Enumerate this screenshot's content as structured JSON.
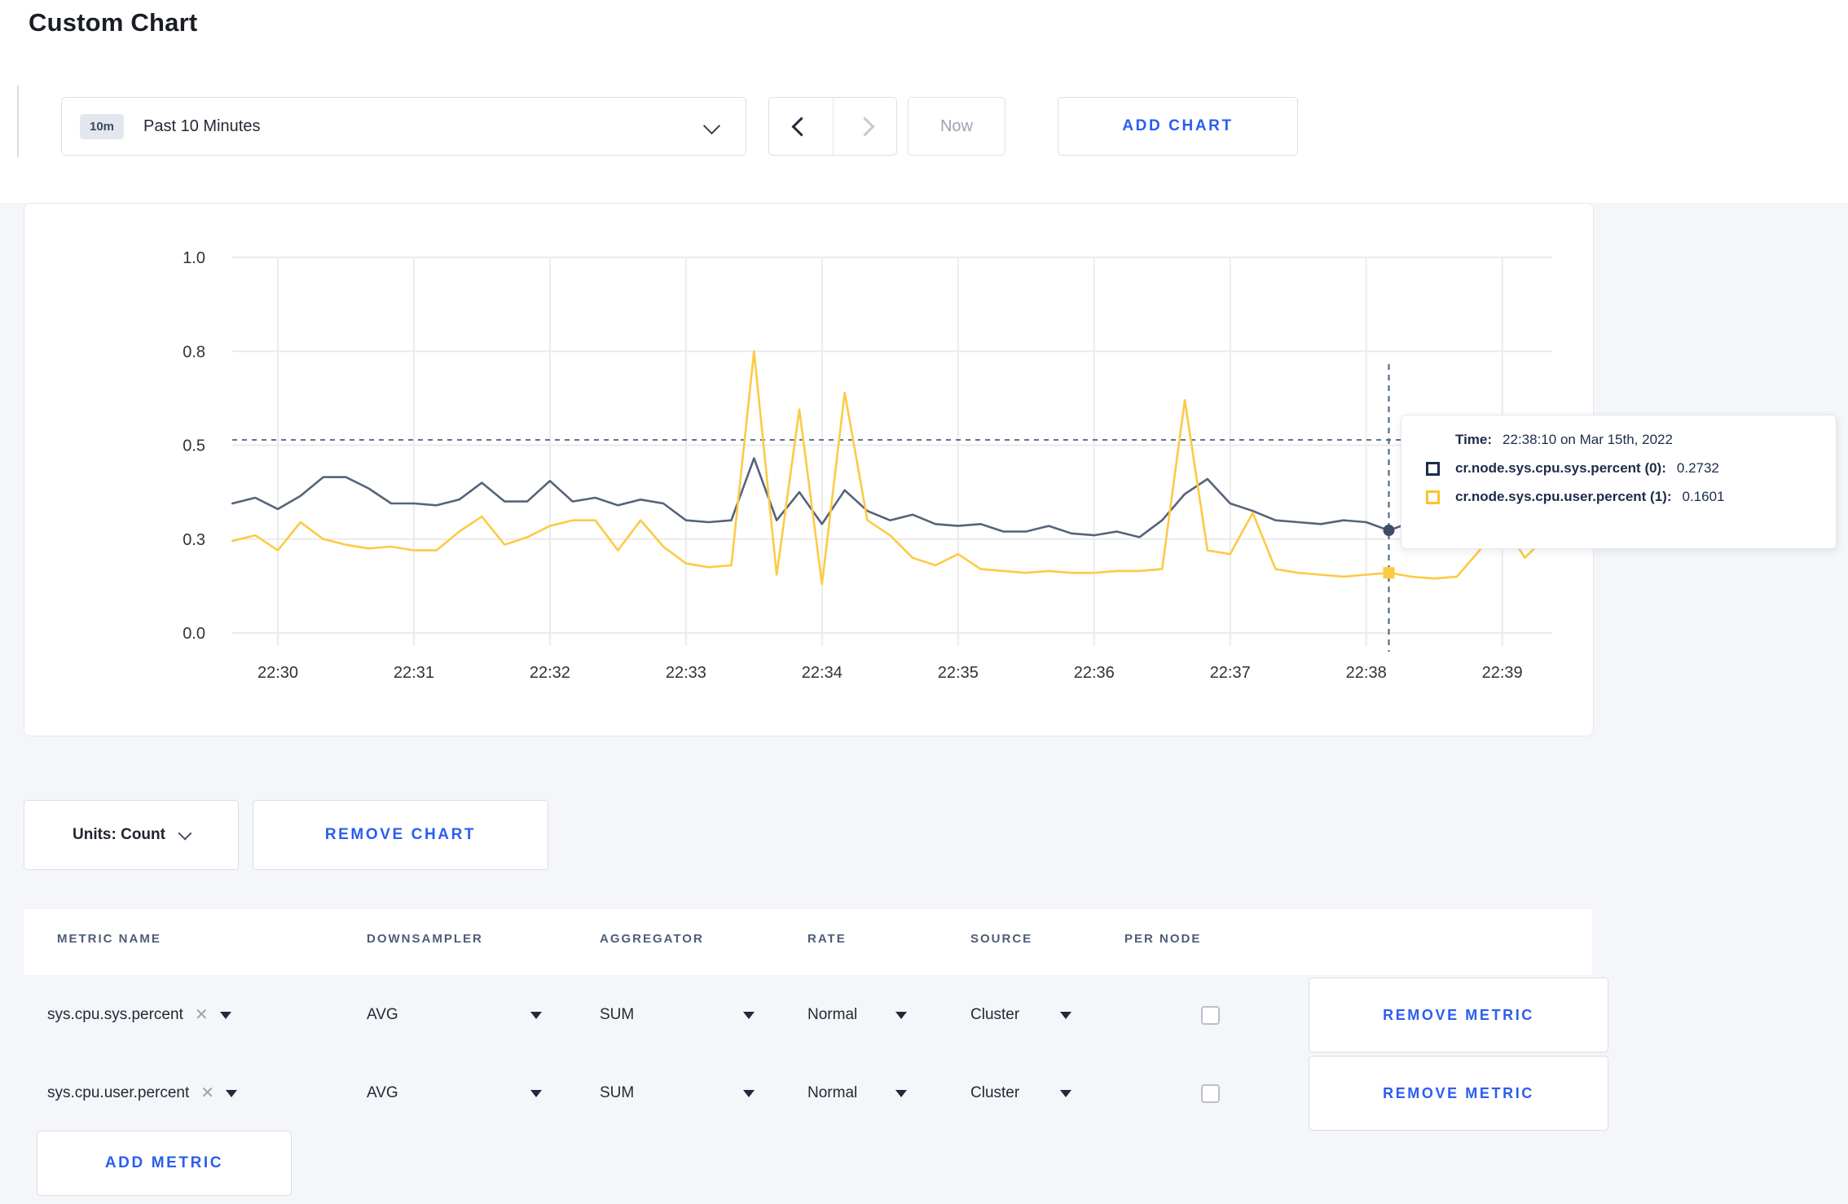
{
  "page": {
    "title": "Custom Chart",
    "background": "#f4f6f9",
    "accent_blue": "#2b5df0"
  },
  "toolbar": {
    "time_badge": "10m",
    "time_label": "Past 10 Minutes",
    "now_label": "Now",
    "add_chart_label": "ADD CHART"
  },
  "chart_data": {
    "type": "line",
    "title": "",
    "xlabel": "",
    "ylabel": "",
    "ylim": [
      0,
      1
    ],
    "grid": true,
    "x_tick_labels": [
      "22:30",
      "22:31",
      "22:32",
      "22:33",
      "22:34",
      "22:35",
      "22:36",
      "22:37",
      "22:38",
      "22:39"
    ],
    "y_ticks": [
      {
        "value": 0.0,
        "label": "0.0"
      },
      {
        "value": 0.25,
        "label": "0.3"
      },
      {
        "value": 0.5,
        "label": "0.5"
      },
      {
        "value": 0.75,
        "label": "0.8"
      },
      {
        "value": 1.0,
        "label": "1.0"
      }
    ],
    "start_time": "22:29:40",
    "step_seconds": 10,
    "series": [
      {
        "name": "cr.node.sys.cpu.sys.percent",
        "color": "#56637a",
        "values": [
          0.345,
          0.36,
          0.33,
          0.365,
          0.415,
          0.415,
          0.385,
          0.345,
          0.345,
          0.34,
          0.355,
          0.4,
          0.35,
          0.35,
          0.405,
          0.35,
          0.36,
          0.34,
          0.355,
          0.345,
          0.3,
          0.295,
          0.3,
          0.465,
          0.3,
          0.375,
          0.29,
          0.38,
          0.325,
          0.3,
          0.315,
          0.29,
          0.285,
          0.29,
          0.27,
          0.27,
          0.285,
          0.265,
          0.26,
          0.27,
          0.255,
          0.3,
          0.37,
          0.41,
          0.345,
          0.325,
          0.3,
          0.295,
          0.29,
          0.3,
          0.295,
          0.2732,
          0.295,
          0.31,
          0.3,
          0.295,
          0.3,
          0.305,
          0.3
        ]
      },
      {
        "name": "cr.node.sys.cpu.user.percent",
        "color": "#fdca44",
        "values": [
          0.245,
          0.26,
          0.22,
          0.295,
          0.25,
          0.235,
          0.225,
          0.23,
          0.22,
          0.22,
          0.27,
          0.31,
          0.235,
          0.255,
          0.285,
          0.3,
          0.3,
          0.22,
          0.3,
          0.23,
          0.185,
          0.175,
          0.18,
          0.75,
          0.155,
          0.595,
          0.13,
          0.64,
          0.3,
          0.26,
          0.2,
          0.18,
          0.21,
          0.17,
          0.165,
          0.16,
          0.165,
          0.16,
          0.16,
          0.165,
          0.165,
          0.17,
          0.62,
          0.22,
          0.21,
          0.32,
          0.17,
          0.16,
          0.155,
          0.15,
          0.155,
          0.1601,
          0.15,
          0.145,
          0.15,
          0.22,
          0.295,
          0.2,
          0.26
        ]
      }
    ],
    "hover": {
      "index": 51,
      "time": "22:38:10",
      "hline_value": 0.514,
      "sys_value": 0.2732,
      "user_value": 0.1601
    },
    "legend_position": "tooltip-overlay"
  },
  "tooltip": {
    "time_label": "Time:",
    "time_value": "22:38:10 on Mar 15th, 2022",
    "rows": [
      {
        "name": "cr.node.sys.cpu.sys.percent (0):",
        "value": "0.2732",
        "color": "#1c2c4a"
      },
      {
        "name": "cr.node.sys.cpu.user.percent (1):",
        "value": "0.1601",
        "color": "#fdc12f"
      }
    ]
  },
  "units_row": {
    "units_label": "Units: Count",
    "remove_chart_label": "REMOVE CHART"
  },
  "metrics": {
    "headers": [
      "METRIC NAME",
      "DOWNSAMPLER",
      "AGGREGATOR",
      "RATE",
      "SOURCE",
      "PER NODE"
    ],
    "rows": [
      {
        "name": "sys.cpu.sys.percent",
        "downsampler": "AVG",
        "aggregator": "SUM",
        "rate": "Normal",
        "source": "Cluster",
        "per_node_checked": false,
        "remove_label": "REMOVE METRIC"
      },
      {
        "name": "sys.cpu.user.percent",
        "downsampler": "AVG",
        "aggregator": "SUM",
        "rate": "Normal",
        "source": "Cluster",
        "per_node_checked": false,
        "remove_label": "REMOVE METRIC"
      }
    ],
    "add_metric_label": "ADD METRIC"
  }
}
